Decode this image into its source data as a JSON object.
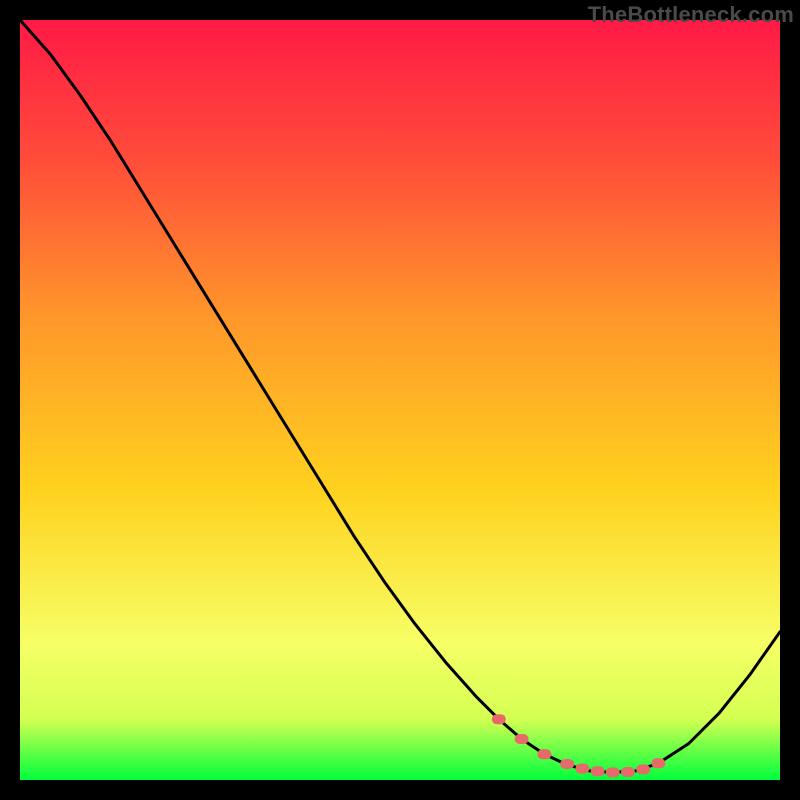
{
  "watermark": "TheBottleneck.com",
  "colors": {
    "gradient_top": "#ff1a46",
    "gradient_mid": "#ffd21f",
    "gradient_low": "#f6ff66",
    "gradient_bottom": "#00ff3c",
    "curve": "#000000",
    "marker": "#e66a6a",
    "frame": "#000000"
  },
  "chart_data": {
    "type": "line",
    "title": "",
    "xlabel": "",
    "ylabel": "",
    "xlim": [
      0,
      100
    ],
    "ylim": [
      0,
      100
    ],
    "series": [
      {
        "name": "curve",
        "x": [
          0,
          4,
          8,
          12,
          16,
          20,
          24,
          28,
          32,
          36,
          40,
          44,
          48,
          52,
          56,
          60,
          63,
          66,
          69,
          72,
          75,
          78,
          81,
          84,
          88,
          92,
          96,
          100
        ],
        "y": [
          100,
          95.5,
          90,
          84,
          77.5,
          71,
          64.5,
          58,
          51.5,
          45,
          38.5,
          32,
          26,
          20.5,
          15.5,
          11,
          8,
          5.4,
          3.4,
          2,
          1.2,
          1,
          1.2,
          2.2,
          4.8,
          8.8,
          13.8,
          19.5
        ]
      },
      {
        "name": "markers",
        "x": [
          63,
          66,
          69,
          72,
          74,
          76,
          78,
          80,
          82,
          84
        ],
        "y": [
          8,
          5.4,
          3.4,
          2.1,
          1.5,
          1.15,
          1.0,
          1.05,
          1.4,
          2.2
        ]
      }
    ]
  }
}
